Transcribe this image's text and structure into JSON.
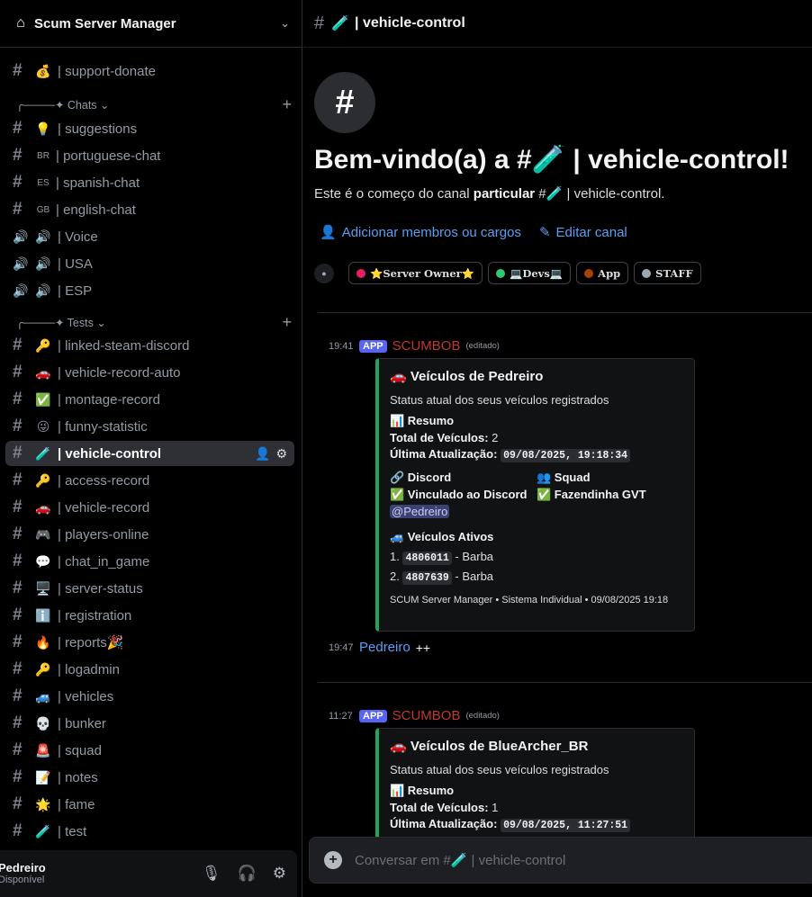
{
  "server": {
    "name": "Scum Server Manager"
  },
  "sidebar": {
    "top_channel": {
      "emoji": "💰",
      "label": "| support-donate"
    },
    "categories": {
      "chats": "✦ Chats",
      "tests": "✦ Tests"
    },
    "chats": [
      {
        "emoji": "💡",
        "label": "| suggestions"
      },
      {
        "code": "BR",
        "label": "| portuguese-chat"
      },
      {
        "code": "ES",
        "label": "| spanish-chat"
      },
      {
        "code": "GB",
        "label": "| english-chat"
      },
      {
        "emoji": "🔊",
        "label": "| Voice"
      },
      {
        "emoji": "🔊",
        "label": "| USA"
      },
      {
        "emoji": "🔊",
        "label": "| ESP"
      }
    ],
    "tests": [
      {
        "emoji": "🔑",
        "label": "| linked-steam-discord"
      },
      {
        "emoji": "🚗",
        "label": "| vehicle-record-auto"
      },
      {
        "emoji": "✅",
        "label": "| montage-record"
      },
      {
        "emoji": "😜",
        "label": "| funny-statistic"
      },
      {
        "emoji": "🧪",
        "label": "| vehicle-control"
      },
      {
        "emoji": "🔑",
        "label": "| access-record"
      },
      {
        "emoji": "🚗",
        "label": "| vehicle-record"
      },
      {
        "emoji": "🎮",
        "label": "| players-online"
      },
      {
        "emoji": "💬",
        "label": "| chat_in_game"
      },
      {
        "emoji": "🖥️",
        "label": "| server-status"
      },
      {
        "emoji": "ℹ️",
        "label": "| registration"
      },
      {
        "emoji": "🔥",
        "label": "| reports🎉"
      },
      {
        "emoji": "🔑",
        "label": "| logadmin"
      },
      {
        "emoji": "🚙",
        "label": "| vehicles"
      },
      {
        "emoji": "💀",
        "label": "| bunker"
      },
      {
        "emoji": "🚨",
        "label": "| squad"
      },
      {
        "emoji": "📝",
        "label": "| notes"
      },
      {
        "emoji": "🌟",
        "label": "| fame"
      },
      {
        "emoji": "🧪",
        "label": "| test"
      }
    ]
  },
  "user": {
    "name": "Pedreiro",
    "status": "Disponível"
  },
  "channel": {
    "emoji": "🧪",
    "name": "| vehicle-control"
  },
  "welcome": {
    "title_prefix": "Bem-vindo(a) a #",
    "title_suffix": " | vehicle-control!",
    "sub_start": "Este é o começo do canal ",
    "sub_bold": "particular",
    "sub_end": " # | vehicle-control.",
    "add_members": "Adicionar membros ou cargos",
    "edit_channel": "Editar canal"
  },
  "roles": [
    {
      "label": "⭐Server Owner⭐",
      "color": "#e91e63"
    },
    {
      "label": "💻Devs💻",
      "color": "#2ecc71"
    },
    {
      "label": "App",
      "color": "#a84300"
    },
    {
      "label": "STAFF",
      "color": "#99aab5"
    }
  ],
  "messages": [
    {
      "time": "19:41",
      "badge": "APP",
      "author": "SCUMBOB",
      "edited": "(editado)",
      "embed": {
        "title": "🚗 Veículos de Pedreiro",
        "desc": "Status atual dos seus veículos registrados",
        "summary": "📊 Resumo",
        "total_label": "Total de Veículos:",
        "total_value": " 2",
        "update_label": "Última Atualização:",
        "update_value": "09/08/2025, 19:18:34",
        "discord_label": "🔗 Discord",
        "discord_value": "✅ Vinculado ao Discord",
        "mention": "@Pedreiro",
        "squad_label": "👥 Squad",
        "squad_value": "✅ Fazendinha GVT",
        "active_label": "🚙 Veículos Ativos",
        "vehicles": [
          {
            "n": "1.",
            "id": "4806011",
            "name": " - Barba"
          },
          {
            "n": "2.",
            "id": "4807639",
            "name": " - Barba"
          }
        ],
        "footer": "SCUM Server Manager • Sistema Individual • 09/08/2025 19:18"
      }
    },
    {
      "time": "19:47",
      "author": "Pedreiro",
      "text": "++"
    },
    {
      "time": "11:27",
      "badge": "APP",
      "author": "SCUMBOB",
      "edited": "(editado)",
      "embed": {
        "title": "🚗 Veículos de BlueArcher_BR",
        "desc": "Status atual dos seus veículos registrados",
        "summary": "📊 Resumo",
        "total_label": "Total de Veículos:",
        "total_value": " 1",
        "update_label": "Última Atualização:",
        "update_value": "09/08/2025, 11:27:51"
      }
    }
  ],
  "composer": {
    "placeholder": "Conversar em #🧪 | vehicle-control"
  }
}
